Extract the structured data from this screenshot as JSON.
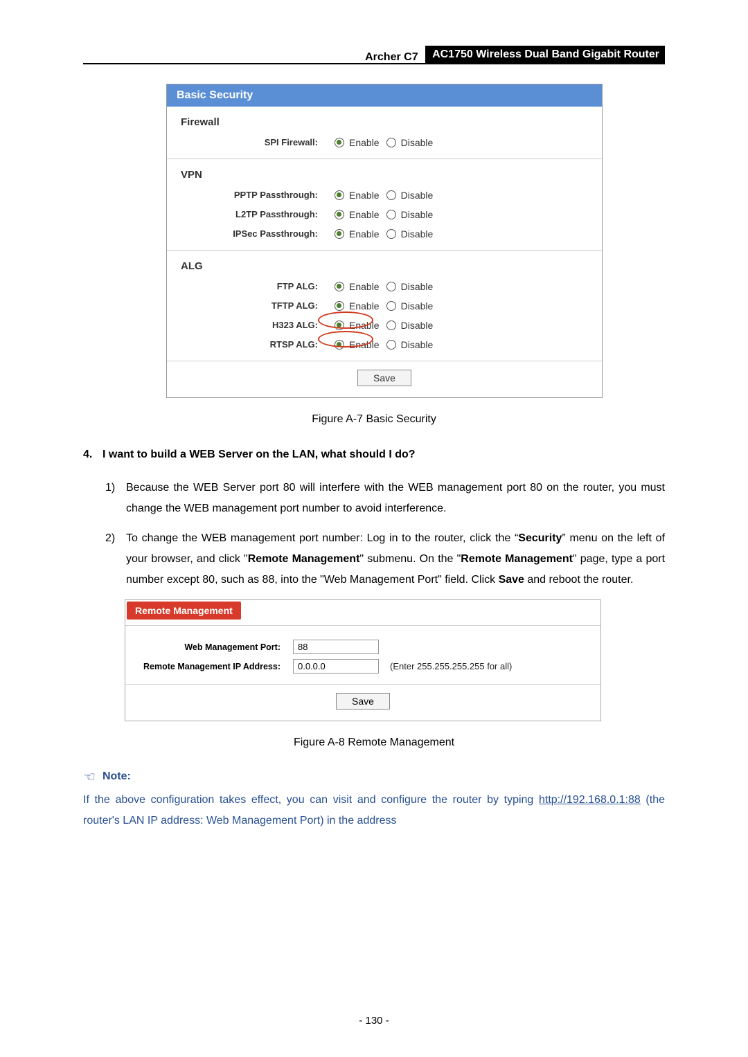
{
  "header": {
    "model": "Archer C7",
    "product": "AC1750 Wireless Dual Band Gigabit Router"
  },
  "panel1": {
    "title": "Basic Security",
    "sections": {
      "firewall": {
        "heading": "Firewall",
        "spi": {
          "label": "SPI Firewall:",
          "enable": "Enable",
          "disable": "Disable"
        }
      },
      "vpn": {
        "heading": "VPN",
        "pptp": {
          "label": "PPTP Passthrough:",
          "enable": "Enable",
          "disable": "Disable"
        },
        "l2tp": {
          "label": "L2TP Passthrough:",
          "enable": "Enable",
          "disable": "Disable"
        },
        "ipsec": {
          "label": "IPSec Passthrough:",
          "enable": "Enable",
          "disable": "Disable"
        }
      },
      "alg": {
        "heading": "ALG",
        "ftp": {
          "label": "FTP ALG:",
          "enable": "Enable",
          "disable": "Disable"
        },
        "tftp": {
          "label": "TFTP ALG:",
          "enable": "Enable",
          "disable": "Disable"
        },
        "h323": {
          "label": "H323 ALG:",
          "enable": "Enable",
          "disable": "Disable"
        },
        "rtsp": {
          "label": "RTSP ALG:",
          "enable": "Enable",
          "disable": "Disable"
        }
      }
    },
    "save": "Save"
  },
  "caption1": "Figure A-7 Basic Security",
  "q4": {
    "num": "4.",
    "text": "I want to build a WEB Server on the LAN, what should I do?"
  },
  "step1": {
    "num": "1)",
    "text": "Because the WEB Server port 80 will interfere with the WEB management port 80 on the router, you must change the WEB management port number to avoid interference."
  },
  "step2": {
    "num": "2)",
    "p1": "To change the WEB management port number: Log in to the router, click the “",
    "b1": "Security",
    "p2": "” menu on the left of your browser, and click \"",
    "b2": "Remote Management",
    "p3": "\" submenu. On the \"",
    "b3": "Remote Management",
    "p4": "\" page, type a port number except 80, such as 88, into the \"Web Management Port\" field. Click ",
    "b4": "Save",
    "p5": " and reboot the router."
  },
  "panel2": {
    "title": "Remote Management",
    "port": {
      "label": "Web Management Port:",
      "value": "88"
    },
    "ip": {
      "label": "Remote Management IP Address:",
      "value": "0.0.0.0",
      "hint": "(Enter 255.255.255.255 for all)"
    },
    "save": "Save"
  },
  "caption2": "Figure A-8 Remote Management",
  "note": {
    "label": "Note:",
    "p1": "If the above configuration takes effect, you can visit and configure the router by typing ",
    "link": "http://192.168.0.1:88",
    "p2": " (the router's LAN IP address: Web Management Port) in the address"
  },
  "pagenum": "- 130 -"
}
